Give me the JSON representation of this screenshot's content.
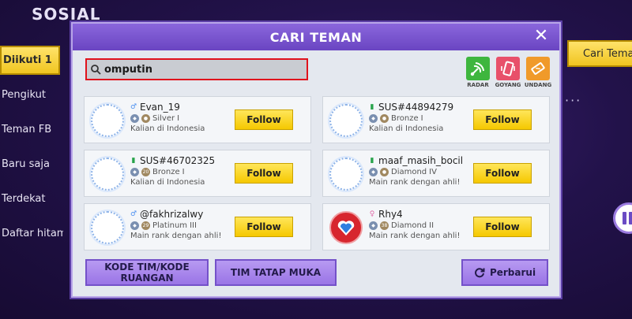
{
  "background": {
    "title": "SOSIAL",
    "sidebar": [
      {
        "label": "Diikuti 1",
        "active": true
      },
      {
        "label": "Pengikut"
      },
      {
        "label": "Teman FB"
      },
      {
        "label": "Baru saja"
      },
      {
        "label": "Terdekat"
      },
      {
        "label": "Daftar hitam"
      }
    ],
    "right_button": "Cari Teman",
    "more": "···"
  },
  "dialog": {
    "title": "CARI TEMAN",
    "close_icon": "close-icon",
    "search": {
      "value": "omputin",
      "placeholder": ""
    },
    "actions": [
      {
        "label": "RADAR",
        "icon": "radar-icon",
        "color": "#3eb63e"
      },
      {
        "label": "GOYANG",
        "icon": "shake-phone-icon",
        "color": "#e8506a"
      },
      {
        "label": "UNDANG",
        "icon": "invite-ticket-icon",
        "color": "#f09a2a"
      }
    ],
    "results": [
      {
        "name": "Evan_19",
        "gender": "♂",
        "rank": "Silver",
        "tier": "I",
        "sub": "Kalian di Indonesia"
      },
      {
        "name": "SUS#44894279",
        "gender": "▮",
        "rank": "Bronze",
        "tier": "I",
        "sub": "Kalian di Indonesia"
      },
      {
        "name": "SUS#46702325",
        "gender": "▮",
        "rank": "Bronze",
        "tier": "I",
        "sub": "Kalian di Indonesia",
        "badge": "20"
      },
      {
        "name": "maaf_masih_bocil",
        "gender": "▮",
        "rank": "Diamond",
        "tier": "IV",
        "sub": "Main rank dengan ahli!"
      },
      {
        "name": "@fakhrizalwy",
        "gender": "♂",
        "rank": "Platinum",
        "tier": "III",
        "sub": "Main rank dengan ahli!",
        "badge": "29"
      },
      {
        "name": "Rhy4",
        "gender": "♀",
        "rank": "Diamond",
        "tier": "II",
        "sub": "Main rank dengan ahli!",
        "badge": "38"
      }
    ],
    "follow_label": "Follow",
    "buttons": {
      "kode": "KODE TIM/KODE RUANGAN",
      "tatap": "TIM TATAP MUKA",
      "perbarui": "Perbarui"
    }
  },
  "colors": {
    "accent": "#7a55d4",
    "follow": "#f5c800",
    "highlight": "#e0121c"
  }
}
